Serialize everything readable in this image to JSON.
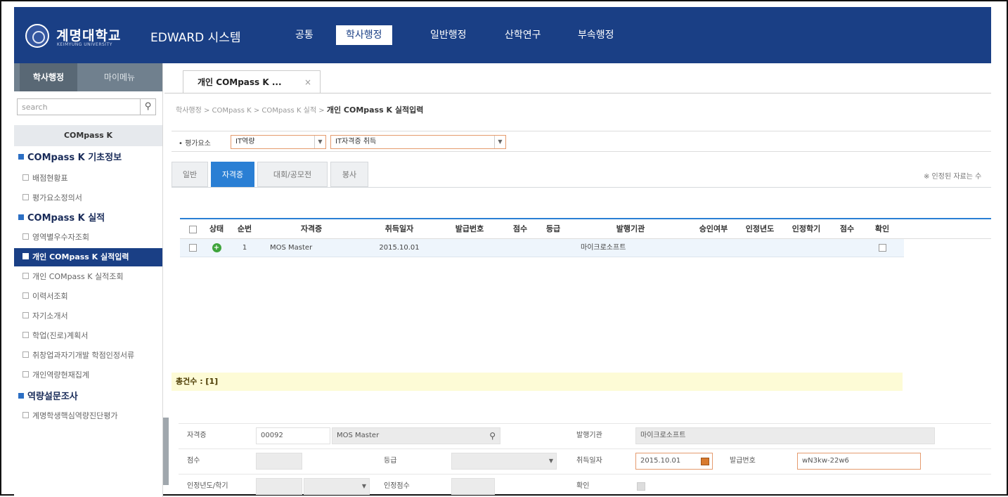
{
  "header": {
    "brand": "계명대학교",
    "brand_sub": "KEIMYUNG UNIVERSITY",
    "system": "EDWARD 시스템",
    "menu": [
      {
        "label": "공통"
      },
      {
        "label": "학사행정"
      },
      {
        "label": "일반행정"
      },
      {
        "label": "산학연구"
      },
      {
        "label": "부속행정"
      }
    ],
    "active_menu": "학사행정"
  },
  "sidebar": {
    "tabs": [
      {
        "label": "학사행정"
      },
      {
        "label": "마이메뉴"
      }
    ],
    "search": {
      "placeholder": "search",
      "value": "search"
    },
    "title": "COMpass K",
    "groups": [
      {
        "label": "COMpass K 기초정보",
        "items": [
          {
            "label": "배점현황표"
          },
          {
            "label": "평가요소정의서"
          }
        ]
      },
      {
        "label": "COMpass K 실적",
        "items": [
          {
            "label": "영역별우수자조회"
          },
          {
            "label": "개인 COMpass K 실적입력"
          },
          {
            "label": "개인 COMpass K 실적조회"
          },
          {
            "label": "이력서조회"
          },
          {
            "label": "자기소개서"
          },
          {
            "label": "학업(진로)계획서"
          },
          {
            "label": "취창업과자기개발 학점인정서류"
          },
          {
            "label": "개인역량현재집계"
          }
        ]
      },
      {
        "label": "역량설문조사",
        "items": [
          {
            "label": "계명학생핵심역량진단평가"
          }
        ]
      }
    ]
  },
  "page_tab": {
    "label": "개인 COMpass K ...",
    "close": "×"
  },
  "breadcrumb": {
    "path": "학사행정 > COMpass K > COMpass K 실적 >",
    "current": "개인 COMpass K 실적입력"
  },
  "filter": {
    "label": "• 평가요소",
    "select1": "IT역량",
    "select2": "IT자격증 취득"
  },
  "content_tabs": [
    {
      "label": "일반"
    },
    {
      "label": "자격증"
    },
    {
      "label": "대회/공모전"
    },
    {
      "label": "봉사"
    }
  ],
  "note": "※ 인정된 자료는 수",
  "grid": {
    "columns": [
      "상태",
      "순번",
      "자격증",
      "취득일자",
      "발급번호",
      "점수",
      "등급",
      "발행기관",
      "승인여부",
      "인정년도",
      "인정학기",
      "점수",
      "확인"
    ],
    "rows": [
      {
        "status": "+",
        "no": "1",
        "cert": "MOS Master",
        "date": "2015.10.01",
        "issue_no": "",
        "score": "",
        "grade": "",
        "issuer": "마이크로소프트",
        "approved": "",
        "year": "",
        "semester": "",
        "score2": "",
        "confirm": ""
      }
    ],
    "total": "총건수 : [1]"
  },
  "form": {
    "cert_label": "자격증",
    "cert_code": "00092",
    "cert_name": "MOS Master",
    "issuer_label": "발행기관",
    "issuer_value": "마이크로소프트",
    "score_label": "점수",
    "score_value": "",
    "grade_label": "등급",
    "grade_value": "",
    "date_label": "취득일자",
    "date_value": "2015.10.01",
    "issue_no_label": "발급번호",
    "issue_no_value": "wN3kw-22w6",
    "year_label": "인정년도/학기",
    "year_value": "",
    "semester_value": "",
    "recog_score_label": "인정점수",
    "recog_score_value": "",
    "confirm_label": "확인"
  },
  "colors": {
    "header_bg": "#1a3f85",
    "active_tab": "#2a7fd4",
    "total_bg": "#fdfbd6",
    "required_border": "#e59b6e"
  }
}
